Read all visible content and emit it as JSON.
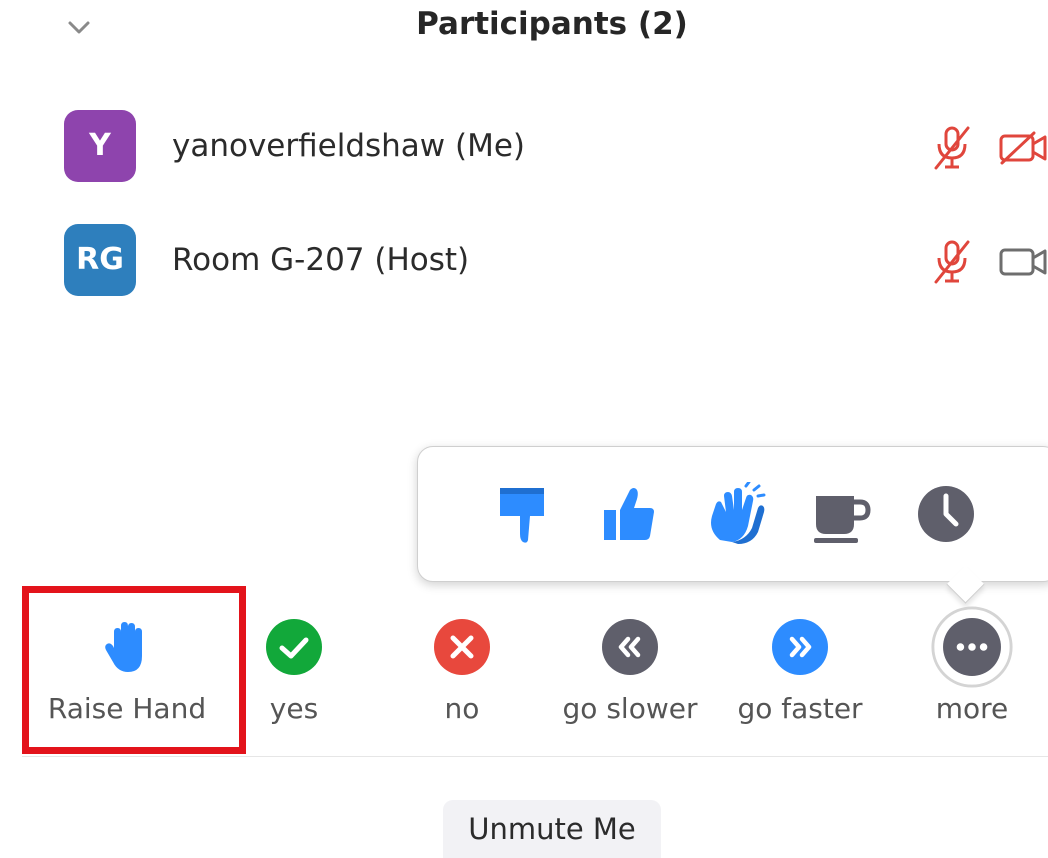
{
  "header": {
    "title": "Participants (2)",
    "collapse_icon": "chevron-down-icon"
  },
  "participants": [
    {
      "initials": "Y",
      "name": "yanoverfieldshaw (Me)",
      "avatar_color": "#8e44ad",
      "mic_state": "muted",
      "video_state": "off"
    },
    {
      "initials": "RG",
      "name": "Room G-207 (Host)",
      "avatar_color": "#2e7fbd",
      "mic_state": "muted",
      "video_state": "on"
    }
  ],
  "reactions": {
    "items": [
      "thumbs-down-icon",
      "thumbs-up-icon",
      "clap-icon",
      "coffee-icon",
      "clock-icon"
    ],
    "blue": "#2d8cff",
    "grey": "#5f5f6b"
  },
  "feedback": {
    "raise_hand": "Raise Hand",
    "yes": "yes",
    "no": "no",
    "go_slower": "go slower",
    "go_faster": "go faster",
    "more": "more"
  },
  "colors": {
    "muted_red": "#e0463c",
    "yes_green": "#12a83a",
    "no_red": "#e8483d",
    "highlight_red": "#e3131b"
  },
  "footer": {
    "unmute_label": "Unmute Me"
  }
}
